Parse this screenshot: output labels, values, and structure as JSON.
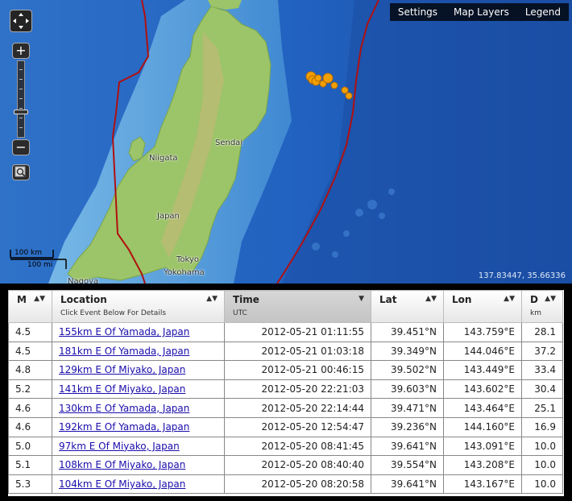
{
  "toolbar": {
    "settings": "Settings",
    "map_layers": "Map Layers",
    "legend": "Legend"
  },
  "zoom": {
    "plus": "+",
    "minus": "−"
  },
  "scalebar": {
    "km_label": "100 km",
    "mi_label": "100 mi"
  },
  "coordinates": "137.83447, 35.66336",
  "map_labels": {
    "sendai": "Sendai",
    "niigata": "Niigata",
    "japan": "Japan",
    "tokyo": "Tokyo",
    "yokohama": "Yokohama",
    "nagoya": "Nagoya"
  },
  "colors": {
    "ocean": "#1e57b0",
    "land": "#9cc468",
    "plate_boundary": "#b01010",
    "quake_marker": "#f2a000"
  },
  "table": {
    "headers": {
      "mag": "M",
      "location": "Location",
      "location_sub": "Click Event Below For Details",
      "time": "Time",
      "time_sub": "UTC",
      "lat": "Lat",
      "lon": "Lon",
      "depth": "D",
      "depth_sub": "km"
    },
    "rows": [
      {
        "mag": "4.5",
        "location": "155km E Of Yamada, Japan",
        "time": "2012-05-21 01:11:55",
        "lat": "39.451°N",
        "lon": "143.759°E",
        "depth": "28.1"
      },
      {
        "mag": "4.5",
        "location": "181km E Of Yamada, Japan",
        "time": "2012-05-21 01:03:18",
        "lat": "39.349°N",
        "lon": "144.046°E",
        "depth": "37.2"
      },
      {
        "mag": "4.8",
        "location": "129km E Of Miyako, Japan",
        "time": "2012-05-21 00:46:15",
        "lat": "39.502°N",
        "lon": "143.449°E",
        "depth": "33.4"
      },
      {
        "mag": "5.2",
        "location": "141km E Of Miyako, Japan",
        "time": "2012-05-20 22:21:03",
        "lat": "39.603°N",
        "lon": "143.602°E",
        "depth": "30.4"
      },
      {
        "mag": "4.6",
        "location": "130km E Of Yamada, Japan",
        "time": "2012-05-20 22:14:44",
        "lat": "39.471°N",
        "lon": "143.464°E",
        "depth": "25.1"
      },
      {
        "mag": "4.6",
        "location": "192km E Of Yamada, Japan",
        "time": "2012-05-20 12:54:47",
        "lat": "39.236°N",
        "lon": "144.160°E",
        "depth": "16.9"
      },
      {
        "mag": "5.0",
        "location": "97km E Of Miyako, Japan",
        "time": "2012-05-20 08:41:45",
        "lat": "39.641°N",
        "lon": "143.091°E",
        "depth": "10.0"
      },
      {
        "mag": "5.1",
        "location": "108km E Of Miyako, Japan",
        "time": "2012-05-20 08:40:40",
        "lat": "39.554°N",
        "lon": "143.208°E",
        "depth": "10.0"
      },
      {
        "mag": "5.3",
        "location": "104km E Of Miyako, Japan",
        "time": "2012-05-20 08:20:58",
        "lat": "39.641°N",
        "lon": "143.167°E",
        "depth": "10.0"
      }
    ]
  }
}
